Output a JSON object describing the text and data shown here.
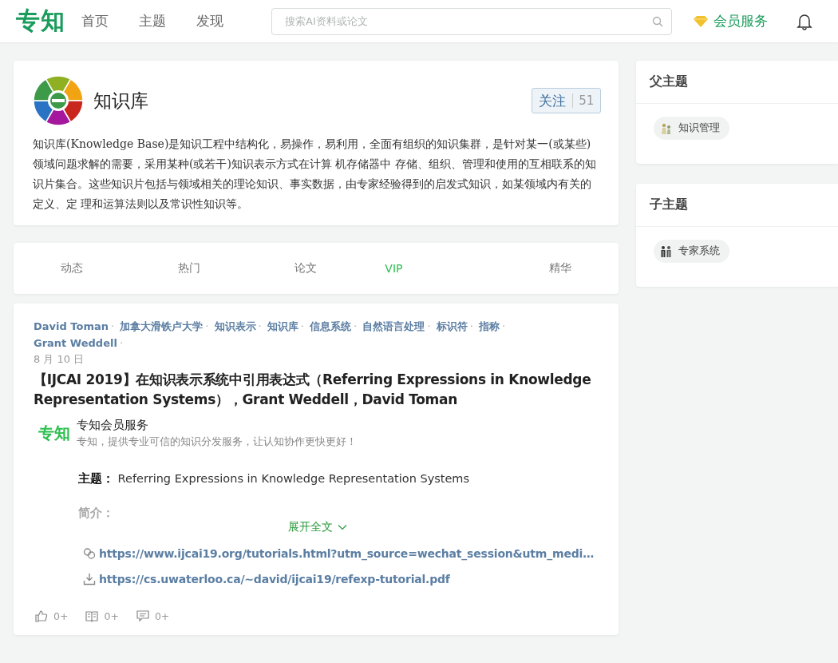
{
  "header": {
    "logo": "专知",
    "nav": [
      {
        "label": "首页",
        "selected": false
      },
      {
        "label": "主题",
        "selected": false
      },
      {
        "label": "发现",
        "selected": false
      }
    ],
    "search": {
      "placeholder": "搜索AI资料或论文"
    },
    "vip_link": "会员服务"
  },
  "topic": {
    "name": "知识库",
    "follow_label": "关注",
    "follow_count": "51",
    "description": "知识库(Knowledge Base)是知识工程中结构化，易操作，易利用，全面有组织的知识集群，是针对某一(或某些)领域问题求解的需要，采用某种(或若干)知识表示方式在计算 机存储器中 存储、组织、管理和使用的互相联系的知识片集合。这些知识片包括与领域相关的理论知识、事实数据，由专家经验得到的启发式知识，如某领域内有关的定义、定 理和运算法则以及常识性知识等。"
  },
  "tabs": [
    {
      "label": "动态",
      "kind": "normal"
    },
    {
      "label": "热门",
      "kind": "normal"
    },
    {
      "label": "论文",
      "kind": "normal"
    },
    {
      "label": "VIP",
      "kind": "vip"
    },
    {
      "label": "精华",
      "kind": "normal"
    }
  ],
  "post": {
    "separator": "·",
    "tags": [
      "David Toman",
      "加拿大滑铁卢大学",
      "知识表示",
      "知识库",
      "信息系统",
      "自然语言处理",
      "标识符",
      "指称",
      "Grant Weddell"
    ],
    "date": "8 月 10 日",
    "title": "【IJCAI 2019】在知识表示系统中引用表达式（Referring Expressions in Knowledge Representation Systems），Grant Weddell，David Toman",
    "source": {
      "logo": "专知",
      "name": "专知会员服务",
      "slogan": "专知，提供专业可信的知识分发服务，让认知协作更快更好！"
    },
    "subject_label": "主题：",
    "subject": "Referring Expressions in Knowledge Representation Systems",
    "intro_label": "简介：",
    "expand": "展开全文",
    "links": [
      {
        "kind": "link",
        "url": "https://www.ijcai19.org/tutorials.html?utm_source=wechat_session&utm_medi…"
      },
      {
        "kind": "download",
        "url": "https://cs.uwaterloo.ca/~david/ijcai19/refexp-tutorial.pdf"
      }
    ],
    "actions": [
      {
        "kind": "like",
        "count": "0+"
      },
      {
        "kind": "read",
        "count": "0+"
      },
      {
        "kind": "comment",
        "count": "0+"
      }
    ]
  },
  "sidebar": [
    {
      "title": "父主题",
      "items": [
        {
          "label": "知识管理",
          "kind": "people"
        }
      ]
    },
    {
      "title": "子主题",
      "items": [
        {
          "label": "专家系统",
          "kind": "figures"
        }
      ]
    }
  ]
}
